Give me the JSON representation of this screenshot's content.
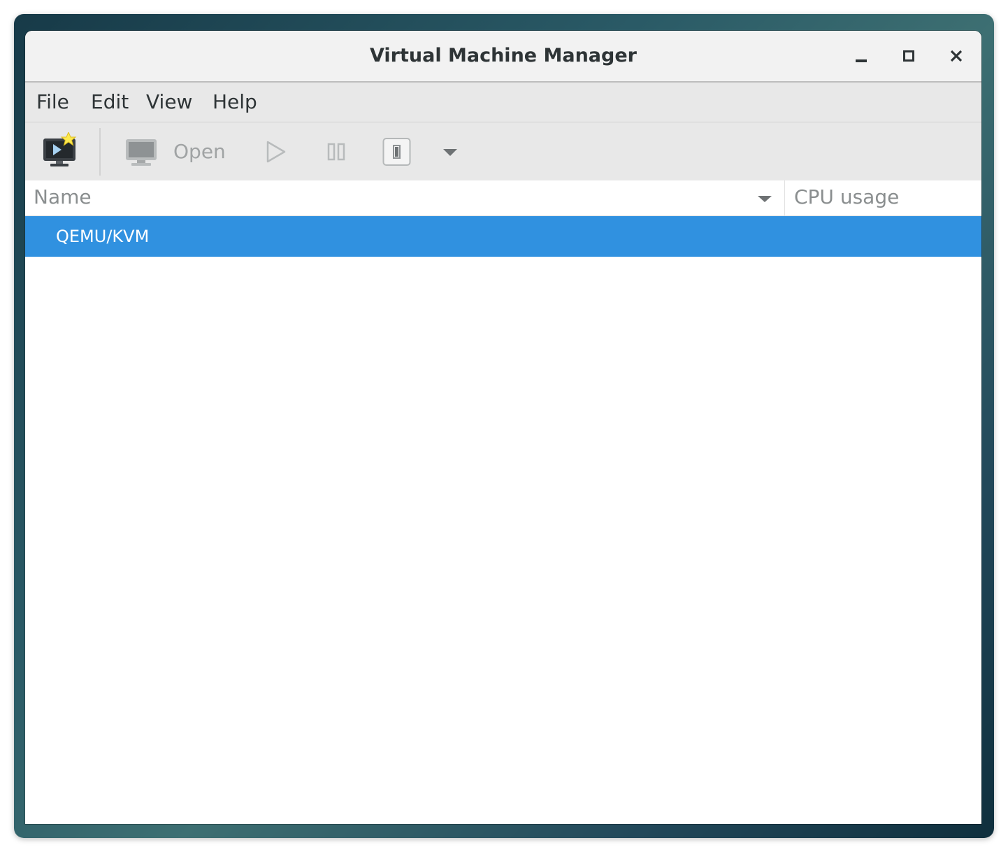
{
  "window": {
    "title": "Virtual Machine Manager"
  },
  "menubar": {
    "items": [
      {
        "label": "File"
      },
      {
        "label": "Edit"
      },
      {
        "label": "View"
      },
      {
        "label": "Help"
      }
    ]
  },
  "toolbar": {
    "new_vm_icon": "new-vm-icon",
    "open_icon": "monitor-icon",
    "open_label": "Open",
    "run_icon": "play-icon",
    "pause_icon": "pause-icon",
    "shutdown_icon": "power-icon",
    "more_icon": "chevron-down-icon"
  },
  "list": {
    "columns": [
      {
        "label": "Name"
      },
      {
        "label": "CPU usage"
      }
    ],
    "rows": [
      {
        "name": "QEMU/KVM",
        "selected": true
      }
    ]
  },
  "colors": {
    "selection": "#3091e0",
    "titlebar": "#f2f2f2",
    "toolbar": "#e8e8e8",
    "text": "#2e3436"
  }
}
